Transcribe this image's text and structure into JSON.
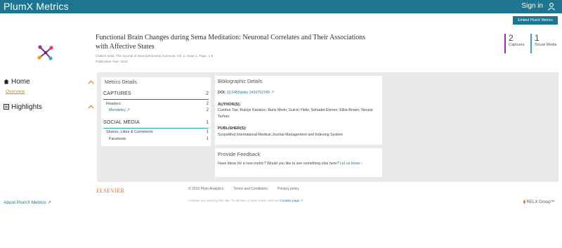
{
  "header": {
    "brand": "PlumX Metrics",
    "sign_in": "Sign in",
    "embed_button": "Embed PlumX Metrics"
  },
  "article": {
    "title": "Functional Brain Changes during Sema Meditation: Neuronal Correlates and Their Associations with Affective States",
    "citation": "Citation Data: The Journal of Neurobehavioral Sciences, Vol. 2, Issue 1, Page. 1-9",
    "pub_year": "Publication Year: 2015"
  },
  "summary_metrics": {
    "captures": {
      "count": "2",
      "label": "Captures",
      "color": "#a02bb0"
    },
    "social": {
      "count": "1",
      "label": "Social Media",
      "color": "#3aa7c2"
    }
  },
  "nav": {
    "home": "Home",
    "overview": "Overview",
    "highlights": "Highlights",
    "about": "About PlumX Metrics"
  },
  "metrics_details": {
    "title": "Metrics Details",
    "captures_label": "CAPTURES",
    "captures_total": "2",
    "readers_label": "Readers",
    "readers_value": "2",
    "mendeley_label": "Mendeley",
    "mendeley_value": "2",
    "social_label": "SOCIAL MEDIA",
    "social_total": "1",
    "shares_label": "Shares, Likes & Comments",
    "shares_value": "1",
    "facebook_label": "Facebook",
    "facebook_value": "1"
  },
  "bibliographic": {
    "title": "Bibliographic Details",
    "doi_label": "DOI:",
    "doi_value": "10.5455/jnbs.1433752749",
    "authors_label": "AUTHOR(S):",
    "authors": "Cumhur Tas; Rukiye Karakoc; Baris Metin; Gulcin Yildiz; Sehadet Ekmen; Elliot Brown; Nevzat Tarhan",
    "publisher_label": "PUBLISHER(S):",
    "publisher": "ScopeMed International Medical Journal Management and Indexing System"
  },
  "feedback": {
    "title": "Provide Feedback",
    "text": "Have ideas for a new metric? Would you like to see something else here?",
    "link": "Let us know"
  },
  "footer": {
    "elsevier": "ELSEVIER",
    "copyright": "© 2019 Plum Analytics",
    "terms": "Terms and Conditions",
    "privacy": "Privacy policy",
    "cookie_text": "Cookies are used by this site. To decline or learn more, visit our",
    "cookie_link": "Cookies page",
    "relx": "RELX Group™"
  },
  "icons": [
    "user-icon",
    "plumx-logo-icon",
    "home-icon",
    "highlights-icon",
    "chevron-up-icon",
    "external-link-icon",
    "arrow-right-icon"
  ]
}
